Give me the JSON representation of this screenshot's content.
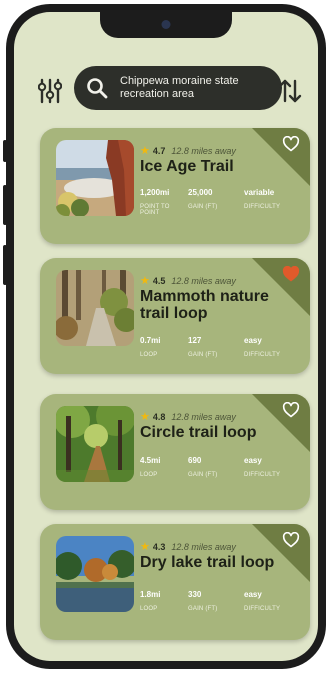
{
  "search": {
    "query": "Chippewa moraine state recreation area"
  },
  "colors": {
    "card": "#a7b57c",
    "corner": "#6f7d43",
    "screen": "#dfe5c8",
    "heart_fav": "#e05a2b",
    "star": "#f1b90f"
  },
  "icons": {
    "filter": "sliders-icon",
    "search": "search-icon",
    "sort": "sort-arrows-icon",
    "heart": "heart-icon",
    "star": "star-icon"
  },
  "trails": [
    {
      "name": "Ice Age Trail",
      "rating": "4.7",
      "distance": "12.8 miles away",
      "favorite": false,
      "stats": [
        {
          "value": "1,200mi",
          "label": "POINT TO POINT"
        },
        {
          "value": "25,000",
          "label": "GAIN (FT)"
        },
        {
          "value": "variable",
          "label": "DIFFICULTY"
        }
      ]
    },
    {
      "name": "Mammoth nature trail loop",
      "rating": "4.5",
      "distance": "12.8 miles away",
      "favorite": true,
      "stats": [
        {
          "value": "0.7mi",
          "label": "LOOP"
        },
        {
          "value": "127",
          "label": "GAIN (FT)"
        },
        {
          "value": "easy",
          "label": "DIFFICULTY"
        }
      ]
    },
    {
      "name": "Circle trail loop",
      "rating": "4.8",
      "distance": "12.8 miles away",
      "favorite": false,
      "stats": [
        {
          "value": "4.5mi",
          "label": "LOOP"
        },
        {
          "value": "690",
          "label": "GAIN (FT)"
        },
        {
          "value": "easy",
          "label": "DIFFICULTY"
        }
      ]
    },
    {
      "name": "Dry lake trail loop",
      "rating": "4.3",
      "distance": "12.8 miles away",
      "favorite": false,
      "stats": [
        {
          "value": "1.8mi",
          "label": "LOOP"
        },
        {
          "value": "330",
          "label": "GAIN (FT)"
        },
        {
          "value": "easy",
          "label": "DIFFICULTY"
        }
      ]
    }
  ]
}
